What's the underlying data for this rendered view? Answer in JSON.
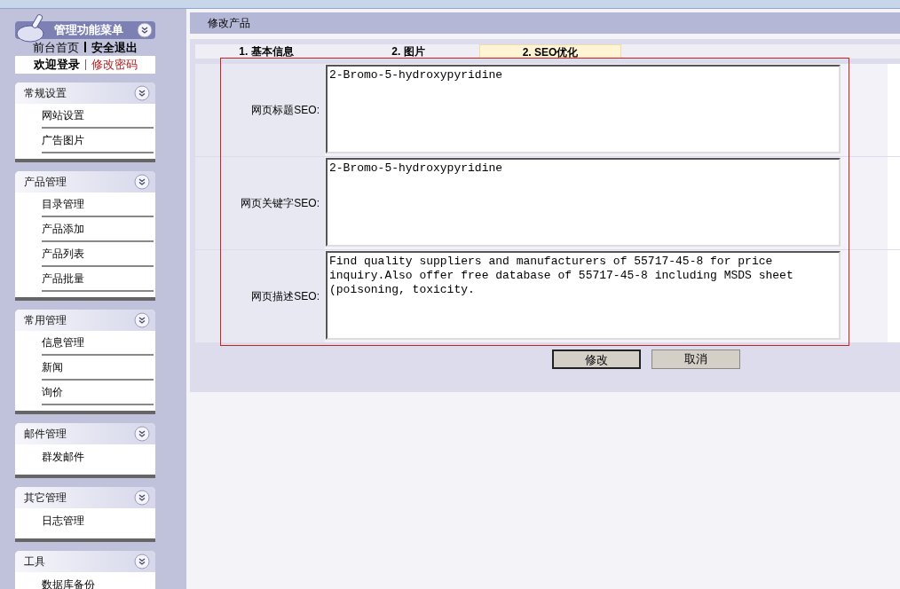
{
  "sidebar": {
    "title": "管理功能菜单",
    "top_links": [
      "前台首页",
      "安全退出"
    ],
    "welcome": "欢迎登录",
    "change_password": "修改密码",
    "groups": [
      {
        "title": "常规设置",
        "items": [
          "网站设置",
          "广告图片"
        ]
      },
      {
        "title": "产品管理",
        "items": [
          "目录管理",
          "产品添加",
          "产品列表",
          "产品批量"
        ]
      },
      {
        "title": "常用管理",
        "items": [
          "信息管理",
          "新闻",
          "询价"
        ]
      },
      {
        "title": "邮件管理",
        "items": [
          "群发邮件"
        ]
      },
      {
        "title": "其它管理",
        "items": [
          "日志管理"
        ]
      },
      {
        "title": "工具",
        "items": [
          "数据库备份"
        ]
      }
    ]
  },
  "main": {
    "title": "修改产品",
    "tabs": [
      {
        "label": "1. 基本信息",
        "selected": false
      },
      {
        "label": "2. 图片",
        "selected": false
      },
      {
        "label": "2. SEO优化",
        "selected": true
      }
    ],
    "fields": [
      {
        "label": "网页标题SEO:",
        "value": "2-Bromo-5-hydroxypyridine"
      },
      {
        "label": "网页关键字SEO:",
        "value": "2-Bromo-5-hydroxypyridine"
      },
      {
        "label": "网页描述SEO:",
        "value": "Find quality suppliers and manufacturers of 55717-45-8 for price inquiry.Also offer free database of 55717-45-8 including MSDS sheet (poisoning, toxicity."
      }
    ],
    "buttons": [
      "修改",
      "取消"
    ]
  }
}
